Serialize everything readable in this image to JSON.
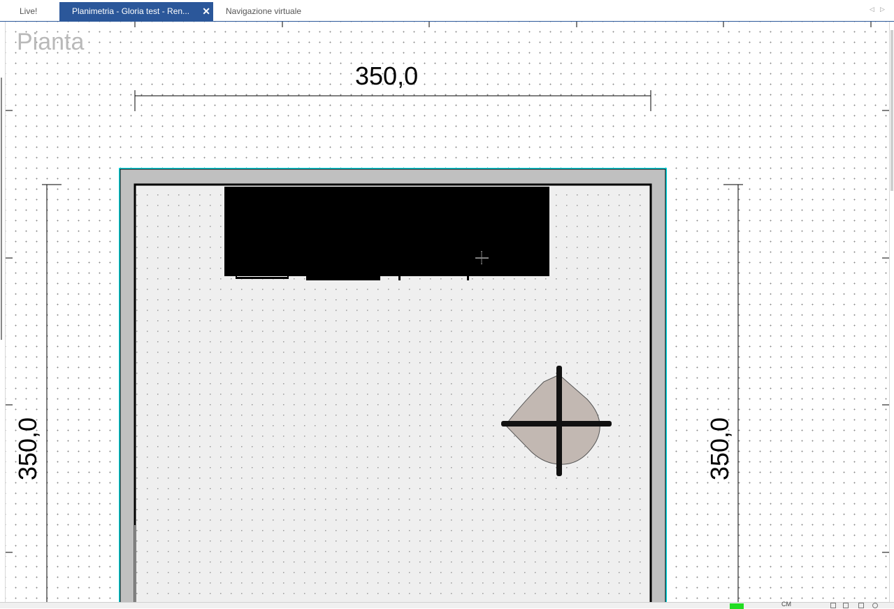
{
  "tabs": [
    {
      "label": "Live!",
      "active": false
    },
    {
      "label": "Planimetria - Gloria test - Ren...",
      "active": true,
      "close": "✕"
    },
    {
      "label": "Navigazione virtuale",
      "active": false
    }
  ],
  "view_label": "Pianta",
  "dimensions": {
    "top": "350,0",
    "left": "350,0",
    "right": "350,0"
  },
  "colors": {
    "tab_active": "#2b579a",
    "selection": "#00d8e0",
    "wall": "#c0c0c0",
    "floor": "#efefef",
    "furniture": "#000000",
    "table_top": "#c2b8b2"
  },
  "icons": {
    "cursor": "crosshair-cursor-icon",
    "scroll_left": "◁",
    "scroll_right": "▷"
  },
  "statusbar": {
    "units": "CM"
  }
}
